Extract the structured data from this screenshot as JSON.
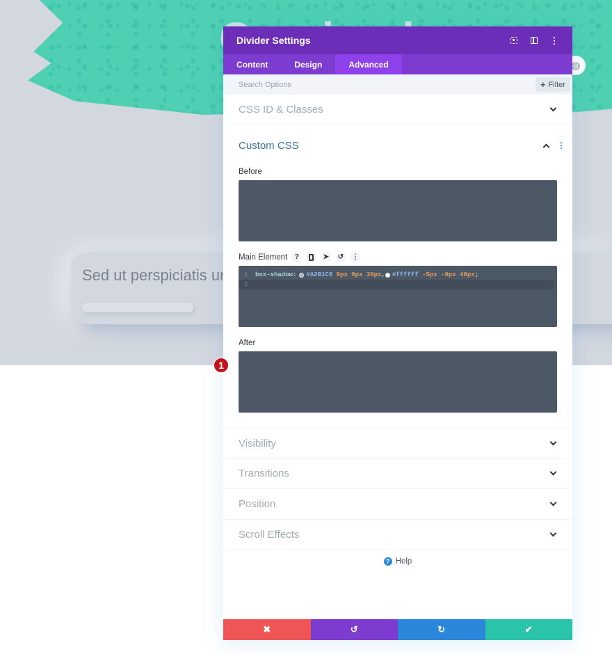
{
  "background": {
    "card_text": "Sed ut perspiciatis ur",
    "globe_icon": "globe-icon",
    "colors": {
      "brush": "#4fd0b3",
      "page_bg": "#d3d7df"
    }
  },
  "modal": {
    "title": "Divider Settings",
    "header_icons": [
      "focus-mode-icon",
      "split-view-icon",
      "more-options-icon"
    ],
    "tabs": [
      {
        "label": "Content",
        "active": false
      },
      {
        "label": "Design",
        "active": false
      },
      {
        "label": "Advanced",
        "active": true
      }
    ],
    "search": {
      "placeholder": "Search Options",
      "value": "",
      "filter_label": "Filter"
    },
    "sections": {
      "css_id_classes": "CSS ID & Classes",
      "custom_css": {
        "title": "Custom CSS",
        "fields": {
          "before": {
            "label": "Before",
            "value": ""
          },
          "main_element": {
            "label": "Main Element",
            "icons": [
              "help-icon",
              "mobile-icon",
              "pointer-icon",
              "reset-icon",
              "more-icon"
            ],
            "code_lines": [
              {
                "number": "1",
                "property": "box-shadow",
                "colon": ":",
                "shadow1": {
                  "color": "#A2B1C6",
                  "values": "9px 9px 30px"
                },
                "comma": ",",
                "shadow2": {
                  "color": "#ffffff",
                  "values": "-5px -0px 40px"
                },
                "semicolon": ";"
              },
              {
                "number": "2"
              }
            ]
          },
          "after": {
            "label": "After",
            "value": ""
          }
        }
      },
      "collapsed": [
        "Visibility",
        "Transitions",
        "Position",
        "Scroll Effects"
      ]
    },
    "step_badge": "1",
    "help_label": "Help",
    "footer": {
      "cancel_icon": "✖",
      "undo_icon": "↺",
      "redo_icon": "↻",
      "save_icon": "✔"
    },
    "colors": {
      "header": "#6c2eb9",
      "tabs": "#7d3bcf",
      "active_tab": "#8f42ec",
      "cancel": "#ef5555",
      "undo": "#7d3bcf",
      "redo": "#2b87da",
      "save": "#29c4a9"
    }
  }
}
